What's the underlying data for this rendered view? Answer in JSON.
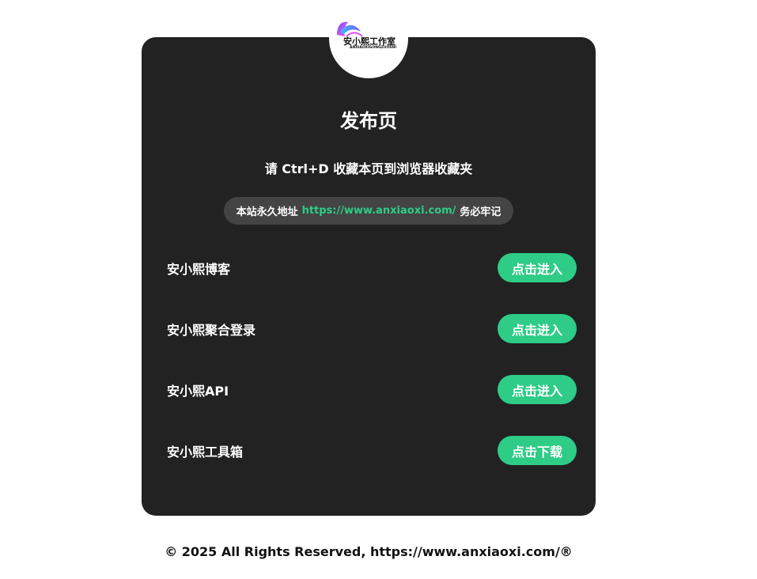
{
  "logo": {
    "title": "安小熙工作室",
    "subtitle": "ANXIAOXIGONGZUOSHI"
  },
  "card": {
    "title": "发布页",
    "subtitle": "请 Ctrl+D 收藏本页到浏览器收藏夹",
    "address": {
      "prefix": "本站永久地址",
      "url": "https://www.anxiaoxi.com/",
      "suffix": "务必牢记"
    },
    "links": [
      {
        "label": "安小熙博客",
        "button": "点击进入"
      },
      {
        "label": "安小熙聚合登录",
        "button": "点击进入"
      },
      {
        "label": "安小熙API",
        "button": "点击进入"
      },
      {
        "label": "安小熙工具箱",
        "button": "点击下载"
      }
    ]
  },
  "footer": {
    "text": "© 2025 All Rights Reserved, https://www.anxiaoxi.com/®"
  },
  "colors": {
    "card_bg": "#222222",
    "pill_bg": "#444444",
    "accent": "#2ecc86"
  }
}
